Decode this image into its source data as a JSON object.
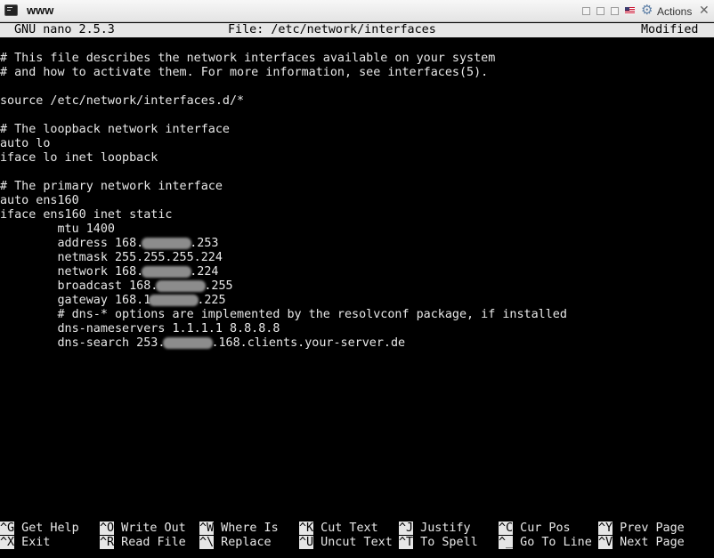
{
  "window": {
    "title": "www",
    "actions_label": "Actions"
  },
  "header": {
    "version": "GNU nano 2.5.3",
    "file": "File: /etc/network/interfaces",
    "status": "Modified"
  },
  "lines": [
    {
      "segments": [
        "# This file describes the network interfaces available on your system"
      ]
    },
    {
      "segments": [
        "# and how to activate them. For more information, see interfaces(5)."
      ]
    },
    {
      "segments": [
        ""
      ]
    },
    {
      "segments": [
        "source /etc/network/interfaces.d/*"
      ]
    },
    {
      "segments": [
        ""
      ]
    },
    {
      "segments": [
        "# The loopback network interface"
      ]
    },
    {
      "segments": [
        "auto lo"
      ]
    },
    {
      "segments": [
        "iface lo inet loopback"
      ]
    },
    {
      "segments": [
        ""
      ]
    },
    {
      "segments": [
        "# The primary network interface"
      ]
    },
    {
      "segments": [
        "auto ens160"
      ]
    },
    {
      "segments": [
        "iface ens160 inet static"
      ]
    },
    {
      "segments": [
        "        mtu 1400"
      ]
    },
    {
      "segments": [
        "        address 168.",
        ".253"
      ]
    },
    {
      "segments": [
        "        netmask 255.255.255.224"
      ]
    },
    {
      "segments": [
        "        network 168.",
        ".224"
      ]
    },
    {
      "segments": [
        "        broadcast 168.",
        ".255"
      ]
    },
    {
      "segments": [
        "        gateway 168.1",
        ".225"
      ]
    },
    {
      "segments": [
        "        # dns-* options are implemented by the resolvconf package, if installed"
      ]
    },
    {
      "segments": [
        "        dns-nameservers 1.1.1.1 8.8.8.8"
      ]
    },
    {
      "segments": [
        "        dns-search 253.",
        ".168.clients.your-server.de"
      ]
    }
  ],
  "shortcuts": [
    {
      "key": "^G",
      "label": "Get Help"
    },
    {
      "key": "^X",
      "label": "Exit"
    },
    {
      "key": "^O",
      "label": "Write Out"
    },
    {
      "key": "^R",
      "label": "Read File"
    },
    {
      "key": "^W",
      "label": "Where Is"
    },
    {
      "key": "^\\",
      "label": "Replace"
    },
    {
      "key": "^K",
      "label": "Cut Text"
    },
    {
      "key": "^U",
      "label": "Uncut Text"
    },
    {
      "key": "^J",
      "label": "Justify"
    },
    {
      "key": "^T",
      "label": "To Spell"
    },
    {
      "key": "^C",
      "label": "Cur Pos"
    },
    {
      "key": "^_",
      "label": "Go To Line"
    },
    {
      "key": "^Y",
      "label": "Prev Page"
    },
    {
      "key": "^V",
      "label": "Next Page"
    }
  ],
  "colors": {
    "terminal_bg": "#000000",
    "terminal_fg": "#e8e8e8",
    "inverse_bg": "#e6e6e6"
  },
  "icons": [
    "terminal-icon",
    "minimize-icon",
    "restore-icon",
    "maximize-icon",
    "us-flag-icon",
    "gear-icon",
    "close-icon"
  ]
}
